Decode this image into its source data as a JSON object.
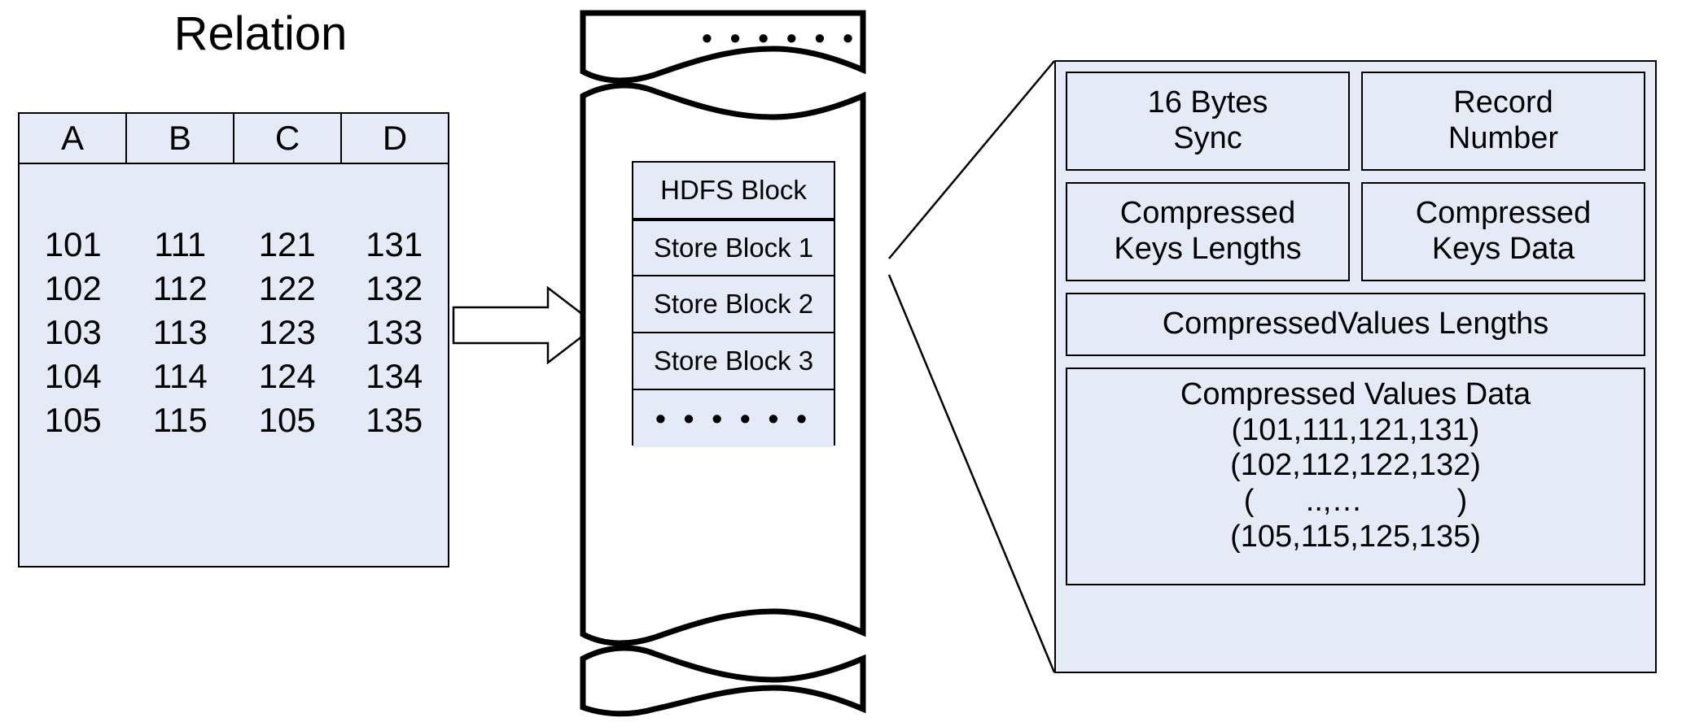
{
  "relation": {
    "title": "Relation",
    "columns": [
      "A",
      "B",
      "C",
      "D"
    ],
    "rows": [
      [
        "101",
        "111",
        "121",
        "131"
      ],
      [
        "102",
        "112",
        "122",
        "132"
      ],
      [
        "103",
        "113",
        "123",
        "133"
      ],
      [
        "104",
        "114",
        "124",
        "134"
      ],
      [
        "105",
        "115",
        "105",
        "135"
      ]
    ]
  },
  "hdfs": {
    "top_ellipsis": "• • •   • • •",
    "blocks": [
      {
        "label": "HDFS Block"
      },
      {
        "label": "Store Block 1"
      },
      {
        "label": "Store Block 2"
      },
      {
        "label": "Store Block 3"
      },
      {
        "label": "• • •   • • •"
      }
    ]
  },
  "record": {
    "sync": "16 Bytes\nSync",
    "sync_line1": "16 Bytes",
    "sync_line2": "Sync",
    "record_number_line1": "Record",
    "record_number_line2": "Number",
    "keys_lengths_line1": "Compressed",
    "keys_lengths_line2": "Keys Lengths",
    "keys_data_line1": "Compressed",
    "keys_data_line2": "Keys  Data",
    "values_lengths": "CompressedValues Lengths",
    "values_data_title": "Compressed Values Data",
    "values_data_lines": [
      "(101,111,121,131)",
      "(102,112,122,132)",
      "(      ..,…           )",
      "(105,115,125,135)"
    ]
  },
  "colors": {
    "box_fill": "#e4ebf7",
    "stroke": "#000000",
    "background": "#ffffff"
  }
}
